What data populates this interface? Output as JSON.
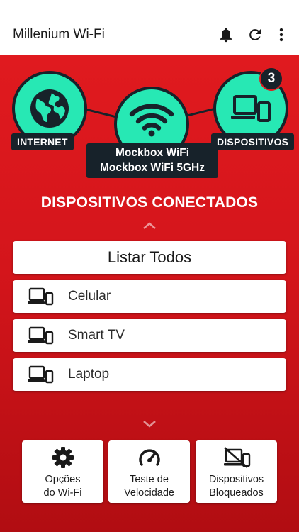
{
  "app": {
    "title": "Millenium Wi-Fi"
  },
  "appbar": {
    "icons": [
      "bell-icon",
      "refresh-icon",
      "more-vert-icon"
    ]
  },
  "network": {
    "internet_label": "INTERNET",
    "devices_label": "DISPOSITIVOS",
    "devices_count": "3",
    "wifi_names": [
      "Mockbox WiFi",
      "Mockbox WiFi 5GHz"
    ]
  },
  "section": {
    "title": "DISPOSITIVOS CONECTADOS",
    "list_all_label": "Listar Todos"
  },
  "devices": [
    {
      "label": "Celular",
      "icon": "devices-icon"
    },
    {
      "label": "Smart TV",
      "icon": "devices-icon"
    },
    {
      "label": "Laptop",
      "icon": "devices-icon"
    }
  ],
  "actions": [
    {
      "label": "Opções\ndo Wi-Fi",
      "icon": "gear-icon"
    },
    {
      "label": "Teste de\nVelocidade",
      "icon": "speedometer-icon"
    },
    {
      "label": "Dispositivos\nBloqueados",
      "icon": "devices-blocked-icon"
    }
  ],
  "colors": {
    "accent_red": "#e01a1f",
    "node_green": "#27e8b4",
    "dark_navy": "#17222a"
  }
}
